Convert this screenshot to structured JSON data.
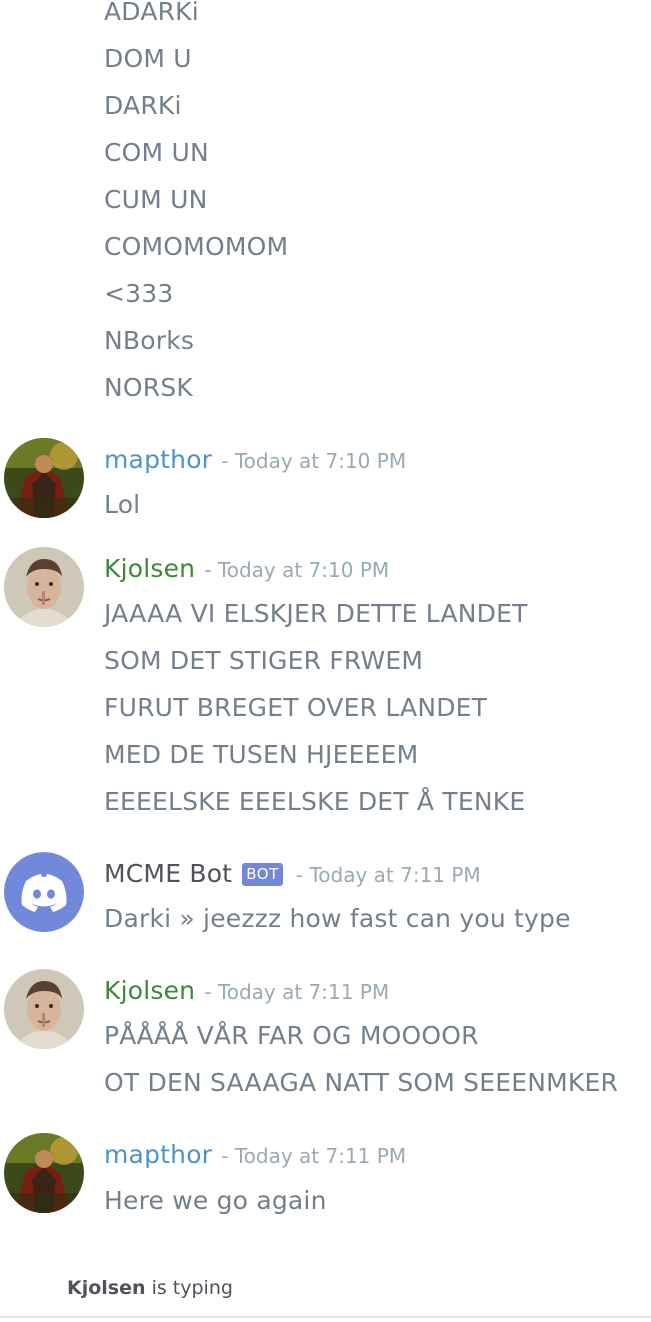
{
  "chat": {
    "continued_lines": [
      "ADARKi",
      "DOM U",
      "DARKi",
      "COM UN",
      "CUM UN",
      "COMOMOMOM",
      "<333",
      "NBorks",
      "NORSK"
    ],
    "messages": [
      {
        "author": "mapthor",
        "timestamp": "- Today at 7:10 PM",
        "lines": [
          "Lol"
        ]
      },
      {
        "author": "Kjolsen",
        "timestamp": "- Today at 7:10 PM",
        "lines": [
          "JAAAA VI ELSKJER DETTE LANDET",
          "SOM DET STIGER FRWEM",
          "FURUT BREGET OVER LANDET",
          "MED DE TUSEN HJEEEEM",
          "EEEELSKE EEELSKE DET Å TENKE"
        ]
      },
      {
        "author": "MCME Bot",
        "bot_tag": "BOT",
        "timestamp": "- Today at 7:11 PM",
        "lines": [
          "Darki » jeezzz how fast can you type"
        ]
      },
      {
        "author": "Kjolsen",
        "timestamp": "- Today at 7:11 PM",
        "lines": [
          "PÅÅÅÅ VÅR FAR OG MOOOOR",
          "OT DEN SAAAGA NATT SOM SEEENMKER"
        ]
      },
      {
        "author": "mapthor",
        "timestamp": "- Today at 7:11 PM",
        "lines": [
          "Here we go again"
        ]
      }
    ]
  },
  "typing_indicator": {
    "user": "Kjolsen",
    "text": " is typing"
  },
  "colors": {
    "message_text": "#737f8d",
    "timestamp": "#99aab5",
    "mapthor_name": "#4e92cc",
    "kjolsen_name": "#3a8a3a",
    "bot_name": "#4f545c",
    "bot_tag_bg": "#7289da",
    "discord_blurple": "#7289da"
  },
  "icons": {
    "bot_avatar": "discord-logo-icon"
  }
}
